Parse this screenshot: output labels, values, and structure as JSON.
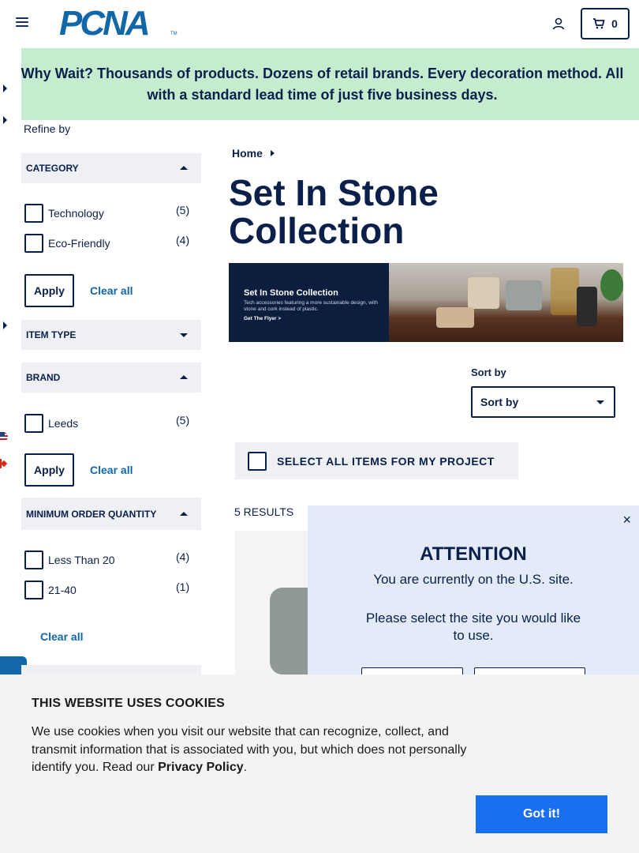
{
  "header": {
    "logo": "PCNA",
    "logo_tm": "TM",
    "cart_count": "0"
  },
  "promo": {
    "text": "Why Wait? Thousands of products. Dozens of retail brands. Every decoration method. All with a standard lead time of just five business days."
  },
  "sidebar": {
    "refine_title": "Refine by",
    "facets": {
      "category": {
        "title": "CATEGORY",
        "options": [
          {
            "label": "Technology",
            "count": "(5)"
          },
          {
            "label": "Eco-Friendly",
            "count": "(4)"
          }
        ],
        "apply": "Apply",
        "clear": "Clear all"
      },
      "item_type": {
        "title": "ITEM TYPE"
      },
      "brand": {
        "title": "BRAND",
        "options": [
          {
            "label": "Leeds",
            "count": "(5)"
          }
        ],
        "apply": "Apply",
        "clear": "Clear all"
      },
      "moq": {
        "title": "MINIMUM ORDER QUANTITY",
        "options": [
          {
            "label": "Less Than 20",
            "count": "(4)"
          },
          {
            "label": "21-40",
            "count": "(1)"
          }
        ],
        "clear": "Clear all"
      }
    }
  },
  "main": {
    "breadcrumb": "Home",
    "title": "Set In Stone Collection",
    "hero": {
      "heading": "Set In Stone Collection",
      "subtext": "Tech accessories featuring a more sustainable design, with stone and cork instead of plastic.",
      "cta": "Get The Flyer >"
    },
    "sort": {
      "label": "Sort by",
      "value": "Sort by"
    },
    "select_all": "SELECT ALL ITEMS FOR MY PROJECT",
    "results": "5 RESULTS"
  },
  "attention": {
    "close": "×",
    "title": "ATTENTION",
    "message": "You are currently on the U.S. site.",
    "ask": "Please select the site you would like to use."
  },
  "cookie": {
    "title": "THIS WEBSITE USES COOKIES",
    "body": "We use cookies when you visit our website that can recognize, collect, and transmit information that is associated with you, but which does not personally identify you. Read our ",
    "link": "Privacy Policy",
    "period": ".",
    "button": "Got it!"
  },
  "colors": {
    "navy": "#0b1f4b",
    "brand_blue": "#1167a8",
    "promo_green": "#c6eccf",
    "facet_gray": "#eef0f4",
    "modal_blue": "#e3ebf8",
    "cookie_button": "#1a6ff0"
  },
  "icons": [
    "hamburger-menu-icon",
    "user-icon",
    "cart-icon",
    "chevron-right-icon",
    "caret-up-icon",
    "caret-down-icon",
    "close-icon",
    "us-flag-icon",
    "canada-flag-icon"
  ]
}
